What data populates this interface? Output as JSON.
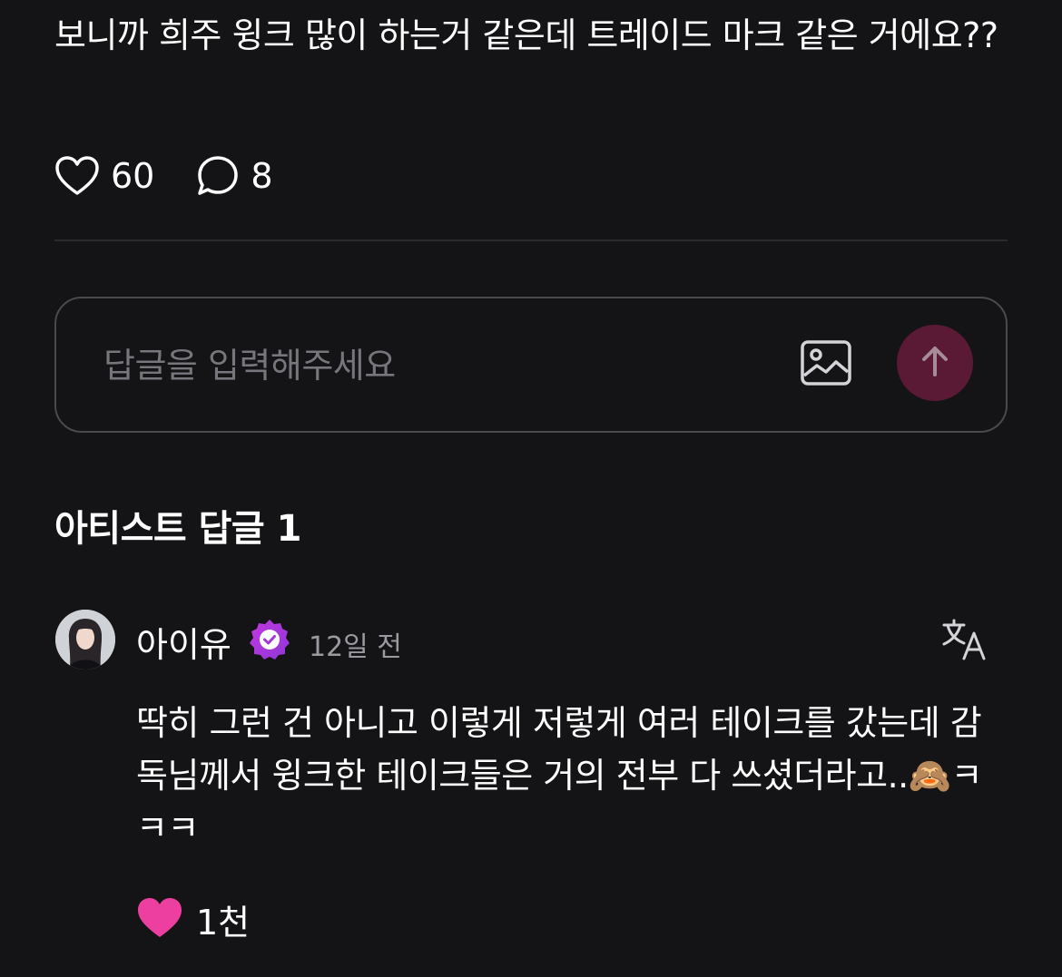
{
  "post": {
    "text": "보니까 희주 윙크 많이 하는거 같은데 트레이드 마크 같은 거에요??",
    "like_count": "60",
    "comment_count": "8"
  },
  "reply_input": {
    "placeholder": "답글을 입력해주세요"
  },
  "artist_replies": {
    "title": "아티스트 답글 1"
  },
  "comment": {
    "author": "아이유",
    "time": "12일 전",
    "text": "딱히 그런 건 아니고 이렇게 저렇게 여러 테이크를 갔는데 감독님께서 윙크한 테이크들은 거의 전부 다 쓰셨더라고..🙈ㅋㅋㅋ",
    "like_count": "1천"
  },
  "colors": {
    "background": "#141315",
    "send_button": "#5a1a36",
    "like_active": "#ec3fa0",
    "verified_badge": "#a937d8"
  },
  "icons": {
    "post_like": "heart-outline-icon",
    "post_comment": "speech-bubble-icon",
    "attach": "image-icon",
    "send": "arrow-up-icon",
    "verified": "verified-badge-icon",
    "translate": "translate-icon",
    "comment_like": "heart-filled-icon"
  }
}
